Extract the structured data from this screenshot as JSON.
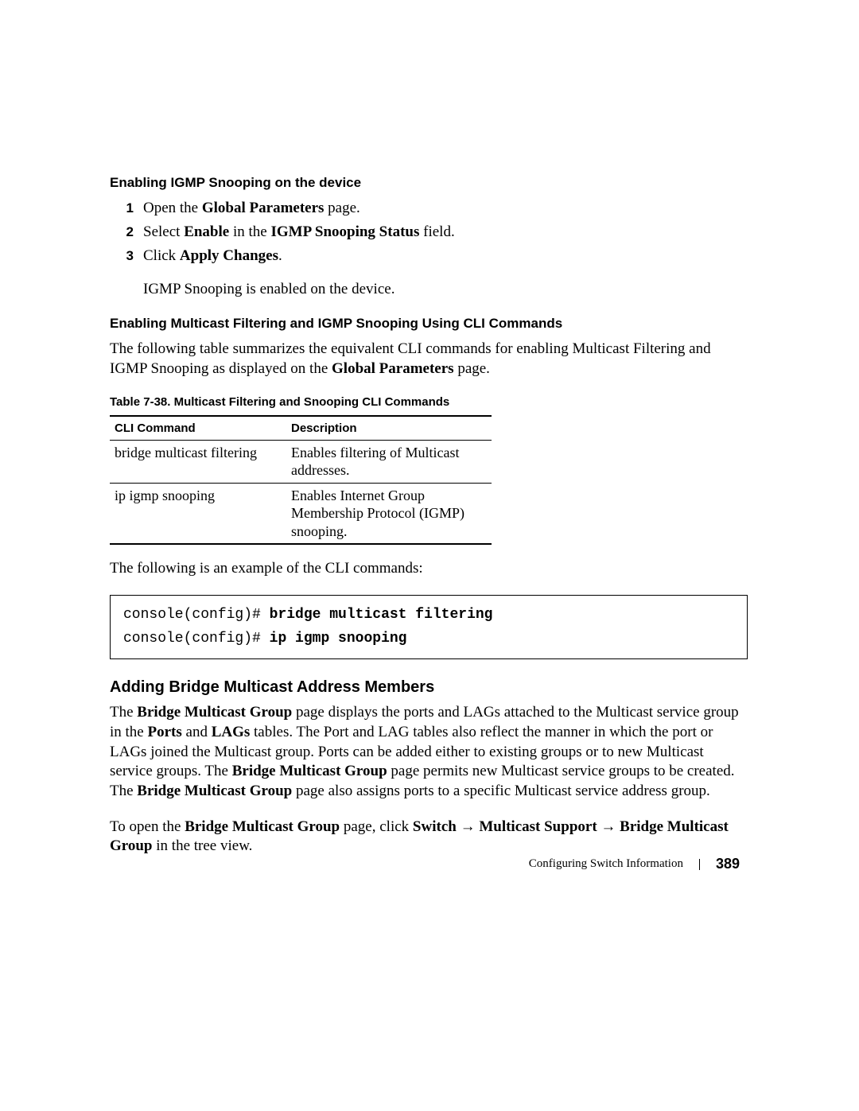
{
  "sections": {
    "igmp_heading": "Enabling IGMP Snooping on the device",
    "steps": [
      {
        "num": "1",
        "pre": "Open the ",
        "bold": "Global Parameters",
        "post": " page."
      },
      {
        "num": "2",
        "pre": "Select ",
        "bold": "Enable",
        "mid": " in the ",
        "bold2": "IGMP Snooping Status",
        "post": " field."
      },
      {
        "num": "3",
        "pre": "Click ",
        "bold": "Apply Changes",
        "post": "."
      }
    ],
    "step_result": "IGMP Snooping is enabled on the device.",
    "cli_heading": "Enabling Multicast Filtering and IGMP Snooping Using CLI Commands",
    "cli_intro_pre": "The following table summarizes the equivalent CLI commands for enabling Multicast Filtering and IGMP Snooping as displayed on the ",
    "cli_intro_bold": "Global Parameters",
    "cli_intro_post": " page.",
    "table_caption": "Table 7-38.    Multicast Filtering and Snooping CLI Commands",
    "table": {
      "headers": [
        "CLI Command",
        "Description"
      ],
      "rows": [
        {
          "cmd": "bridge multicast filtering",
          "desc": "Enables filtering of Multicast addresses."
        },
        {
          "cmd": "ip igmp snooping",
          "desc": "Enables Internet Group Membership Protocol (IGMP) snooping."
        }
      ]
    },
    "cli_example_intro": "The following is an example of the CLI commands:",
    "code": {
      "line1_prompt": "console(config)# ",
      "line1_cmd": "bridge multicast filtering",
      "line2_prompt": "console(config)# ",
      "line2_cmd": "ip igmp snooping"
    },
    "adding_heading": "Adding Bridge Multicast Address Members",
    "adding_para": {
      "t1": "The ",
      "b1": "Bridge Multicast Group",
      "t2": " page displays the ports and LAGs attached to the Multicast service group in the ",
      "b2": "Ports",
      "t3": " and ",
      "b3": "LAGs",
      "t4": " tables. The Port and LAG tables also reflect the manner in which the port or LAGs joined the Multicast group. Ports can be added either to existing groups or to new Multicast service groups. The ",
      "b4": "Bridge Multicast Group",
      "t5": " page permits new Multicast service groups to be created. The ",
      "b5": "Bridge Multicast Group",
      "t6": " page also assigns ports to a specific Multicast service address group."
    },
    "open_para": {
      "t1": "To open the ",
      "b1": "Bridge Multicast Group",
      "t2": " page, click ",
      "b2": "Switch",
      "arrow1": " → ",
      "b3": "Multicast Support",
      "arrow2": " → ",
      "b4": "Bridge Multicast Group",
      "t3": " in the tree view."
    }
  },
  "footer": {
    "section": "Configuring Switch Information",
    "page": "389"
  }
}
